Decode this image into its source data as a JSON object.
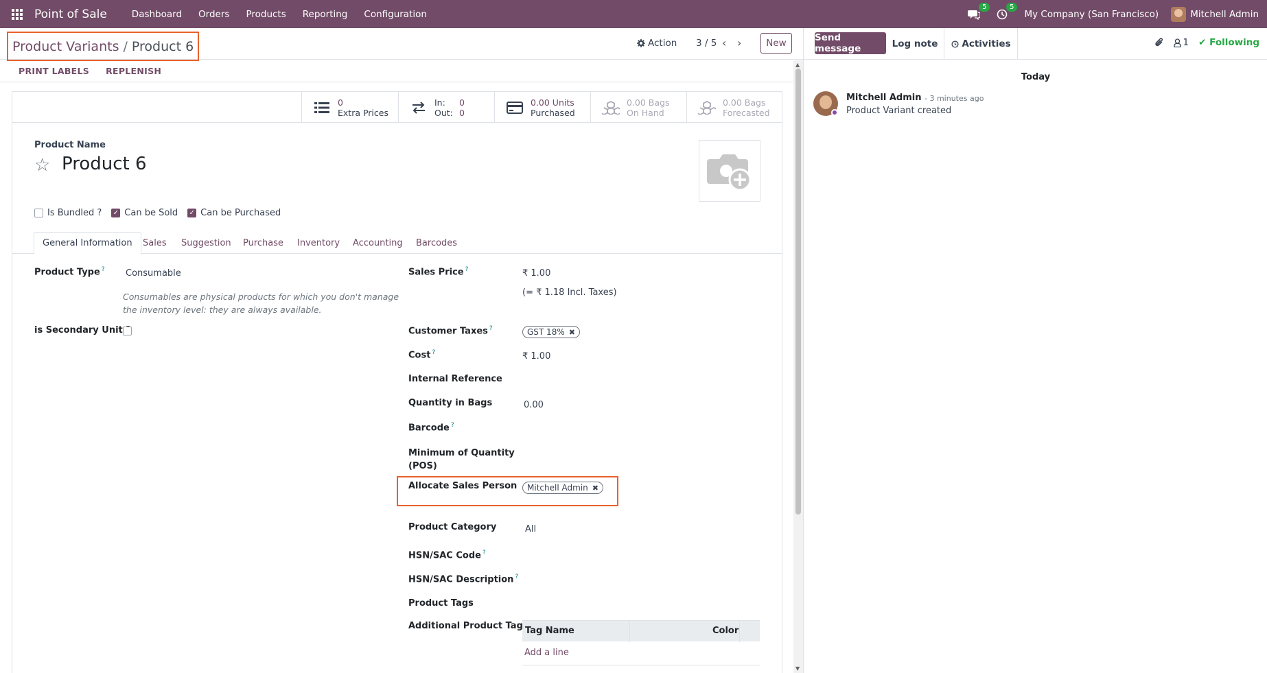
{
  "navbar": {
    "brand": "Point of Sale",
    "menu": [
      "Dashboard",
      "Orders",
      "Products",
      "Reporting",
      "Configuration"
    ],
    "messages_count": "5",
    "activities_count": "5",
    "company": "My Company (San Francisco)",
    "user": "Mitchell Admin"
  },
  "control": {
    "breadcrumb_parent": "Product Variants",
    "breadcrumb_sep": "/",
    "breadcrumb_current": "Product 6",
    "action_label": "Action",
    "pager": "3 / 5",
    "new_label": "New"
  },
  "header_buttons": [
    "PRINT LABELS",
    "REPLENISH"
  ],
  "stats": [
    {
      "value": "0",
      "label": "Extra Prices"
    },
    {
      "in_label": "In:",
      "in_value": "0",
      "out_label": "Out:",
      "out_value": "0"
    },
    {
      "value": "0.00 Units",
      "label": "Purchased"
    },
    {
      "value": "0.00 Bags",
      "label": "On Hand"
    },
    {
      "value": "0.00 Bags",
      "label": "Forecasted"
    }
  ],
  "product": {
    "name_label": "Product Name",
    "name": "Product 6",
    "checks": [
      {
        "label": "Is Bundled ?",
        "checked": false
      },
      {
        "label": "Can be Sold",
        "checked": true
      },
      {
        "label": "Can be Purchased",
        "checked": true
      }
    ]
  },
  "tabs": [
    "General Information",
    "Sales",
    "Suggestion",
    "Purchase",
    "Inventory",
    "Accounting",
    "Barcodes"
  ],
  "left_fields": {
    "product_type_label": "Product Type",
    "product_type_value": "Consumable",
    "product_type_note": "Consumables are physical products for which you don't manage the inventory level: they are always available.",
    "secondary_unit_label": "is Secondary Unit ?"
  },
  "right_fields": {
    "sales_price_label": "Sales Price",
    "sales_price_value": "₹ 1.00",
    "sales_price_incl": "(= ₹ 1.18 Incl. Taxes)",
    "customer_taxes_label": "Customer Taxes",
    "customer_taxes_tag": "GST 18%",
    "cost_label": "Cost",
    "cost_value": "₹ 1.00",
    "internal_ref_label": "Internal Reference",
    "qty_bags_label": "Quantity in Bags",
    "qty_bags_value": "0.00",
    "barcode_label": "Barcode",
    "min_qty_label_1": "Minimum of Quantity",
    "min_qty_label_2": "(POS)",
    "sales_person_label": "Allocate Sales Person",
    "sales_person_tag": "Mitchell Admin",
    "category_label": "Product Category",
    "category_value": "All",
    "hsn_code_label": "HSN/SAC Code",
    "hsn_desc_label": "HSN/SAC Description",
    "product_tags_label": "Product Tags",
    "additional_tag_label": "Additional Product Tag",
    "table_col_1": "Tag Name",
    "table_col_2": "Color",
    "add_line": "Add a line"
  },
  "chatter": {
    "send_message": "Send message",
    "log_note": "Log note",
    "activities": "Activities",
    "followers_count": "1",
    "following": "Following",
    "today": "Today",
    "author": "Mitchell Admin",
    "time": "- 3 minutes ago",
    "body": "Product Variant created"
  },
  "colors": {
    "brand": "#714b67",
    "highlight": "#e8622c",
    "badge": "#28a745",
    "following": "#28a745"
  }
}
